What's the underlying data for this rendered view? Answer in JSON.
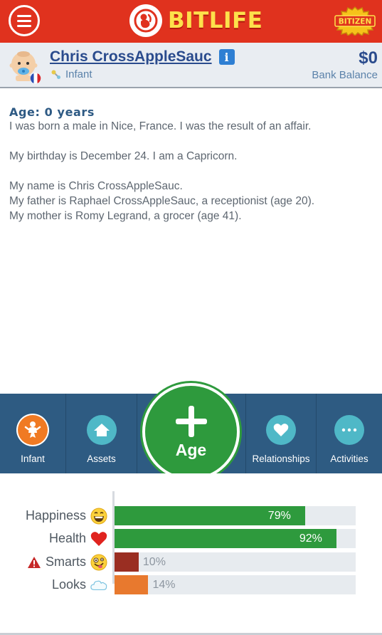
{
  "header": {
    "logo_text": "BITLIFE",
    "bitizen_badge": "BITIZEN",
    "menu_icon": "hamburger-icon"
  },
  "profile": {
    "name": "Chris CrossAppleSauc",
    "life_stage": "Infant",
    "balance_value": "$0",
    "balance_label": "Bank Balance",
    "country_flag": "france-flag-icon"
  },
  "log": {
    "age_heading": "Age: 0 years",
    "lines": [
      "I was born a male in Nice, France. I was the result of an affair.",
      "",
      "My birthday is December 24. I am a Capricorn.",
      "",
      "My name is Chris CrossAppleSauc.",
      "My father is Raphael CrossAppleSauc, a receptionist (age 20).",
      "My mother is Romy Legrand, a grocer (age 41)."
    ]
  },
  "nav": {
    "items": [
      {
        "label": "Infant",
        "icon": "baby-icon",
        "color": "#f07a23"
      },
      {
        "label": "Assets",
        "icon": "house-icon",
        "color": "#4fb8c7"
      },
      {
        "label": "Relationships",
        "icon": "heart-icon",
        "color": "#4fb8c7"
      },
      {
        "label": "Activities",
        "icon": "ellipsis-icon",
        "color": "#4fb8c7"
      }
    ],
    "age_button": {
      "label": "Age",
      "icon": "plus-icon",
      "color": "#2e9a3d"
    }
  },
  "stats": [
    {
      "label": "Happiness",
      "value": 79,
      "display": "79%",
      "color": "#2e9a3d",
      "icon": "grinning-face-icon",
      "warning": false
    },
    {
      "label": "Health",
      "value": 92,
      "display": "92%",
      "color": "#2e9a3d",
      "icon": "red-heart-icon",
      "warning": false
    },
    {
      "label": "Smarts",
      "value": 10,
      "display": "10%",
      "color": "#9a2e22",
      "icon": "zany-face-icon",
      "warning": true
    },
    {
      "label": "Looks",
      "value": 14,
      "display": "14%",
      "color": "#e8792e",
      "icon": "cloud-icon",
      "warning": false
    }
  ]
}
